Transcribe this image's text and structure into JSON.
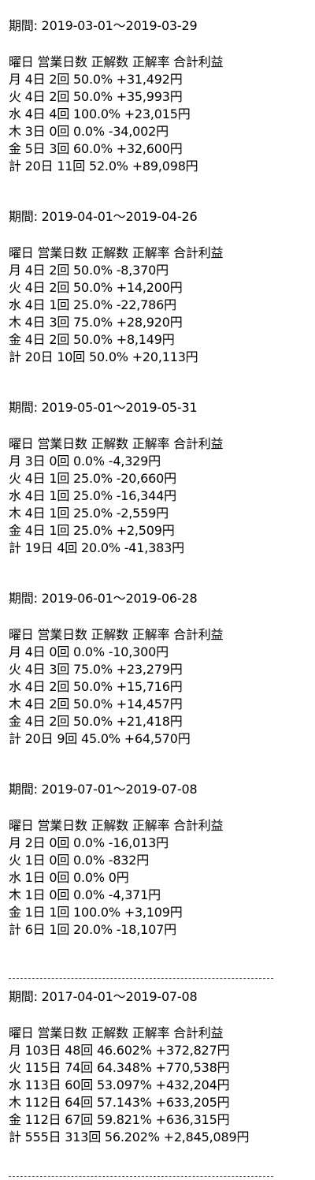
{
  "header_label": "曜日 営業日数 正解数 正解率 合計利益",
  "sections": [
    {
      "period": "期間: 2019-03-01～2019-03-29",
      "rows": [
        "月 4日 2回 50.0% +31,492円",
        "火 4日 2回 50.0% +35,993円",
        "水 4日 4回 100.0% +23,015円",
        "木 3日 0回 0.0% -34,002円",
        "金 5日 3回 60.0% +32,600円",
        "計 20日 11回 52.0% +89,098円"
      ]
    },
    {
      "period": "期間: 2019-04-01～2019-04-26",
      "rows": [
        "月 4日 2回 50.0% -8,370円",
        "火 4日 2回 50.0% +14,200円",
        "水 4日 1回 25.0% -22,786円",
        "木 4日 3回 75.0% +28,920円",
        "金 4日 2回 50.0% +8,149円",
        "計 20日 10回 50.0% +20,113円"
      ]
    },
    {
      "period": "期間: 2019-05-01～2019-05-31",
      "rows": [
        "月 3日 0回 0.0% -4,329円",
        "火 4日 1回 25.0% -20,660円",
        "水 4日 1回 25.0% -16,344円",
        "木 4日 1回 25.0% -2,559円",
        "金 4日 1回 25.0% +2,509円",
        "計 19日 4回 20.0% -41,383円"
      ]
    },
    {
      "period": "期間: 2019-06-01～2019-06-28",
      "rows": [
        "月 4日 0回 0.0% -10,300円",
        "火 4日 3回 75.0% +23,279円",
        "水 4日 2回 50.0% +15,716円",
        "木 4日 2回 50.0% +14,457円",
        "金 4日 2回 50.0% +21,418円",
        "計 20日 9回 45.0% +64,570円"
      ]
    },
    {
      "period": "期間: 2019-07-01～2019-07-08",
      "rows": [
        "月 2日 0回 0.0% -16,013円",
        "火 1日 0回 0.0% -832円",
        "水 1日 0回 0.0% 0円",
        "木 1日 0回 0.0% -4,371円",
        "金 1日 1回 100.0% +3,109円",
        "計 6日 1回 20.0% -18,107円"
      ]
    },
    {
      "period": "期間: 2017-04-01～2019-07-08",
      "rows": [
        "月 103日 48回 46.602% +372,827円",
        "火 115日 74回 64.348% +770,538円",
        "水 113日 60回 53.097% +432,204円",
        "木 112日 64回 57.143% +633,205円",
        "金 112日 67回 59.821% +636,315円",
        "計 555日 313回 56.202% +2,845,089円"
      ]
    }
  ]
}
